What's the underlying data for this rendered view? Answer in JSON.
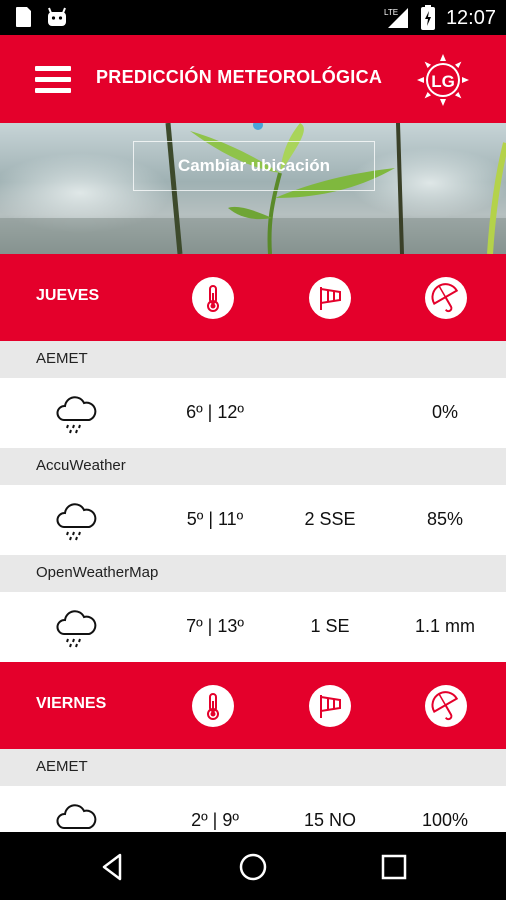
{
  "status_bar": {
    "time": "12:07",
    "network": "LTE"
  },
  "app_bar": {
    "title": "PREDICCIÓN METEOROLÓGICA",
    "logo_text": "LG"
  },
  "hero": {
    "change_location_label": "Cambiar ubicación"
  },
  "days": [
    {
      "name": "JUEVES",
      "sources": [
        {
          "name": "AEMET",
          "temp": "6º | 12º",
          "wind": "",
          "rain": "0%"
        },
        {
          "name": "AccuWeather",
          "temp": "5º | 11º",
          "wind": "2 SSE",
          "rain": "85%"
        },
        {
          "name": "OpenWeatherMap",
          "temp": "7º | 13º",
          "wind": "1 SE",
          "rain": "1.1 mm"
        }
      ]
    },
    {
      "name": "VIERNES",
      "sources": [
        {
          "name": "AEMET",
          "temp": "2º | 9º",
          "wind": "15 NO",
          "rain": "100%"
        }
      ]
    }
  ],
  "colors": {
    "brand_red": "#e4002b",
    "source_row_bg": "#e8e8e8"
  },
  "icons": {
    "column_headers": [
      "thermometer-icon",
      "windsock-icon",
      "umbrella-icon"
    ],
    "weather": "rain-cloud-icon",
    "nav": [
      "back-icon",
      "home-icon",
      "recents-icon"
    ]
  }
}
